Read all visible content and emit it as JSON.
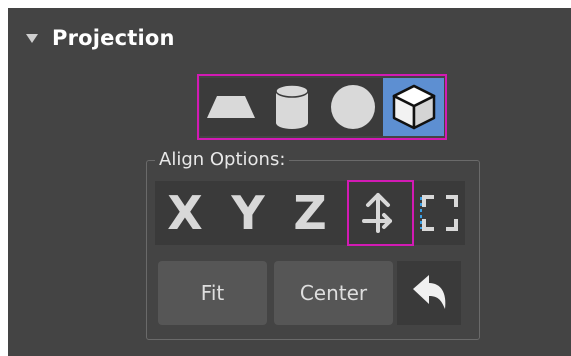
{
  "rollout": {
    "title": "Projection"
  },
  "projection": {
    "buttons": [
      {
        "name": "planar-icon",
        "active": false
      },
      {
        "name": "cylinder-icon",
        "active": false
      },
      {
        "name": "sphere-icon",
        "active": false
      },
      {
        "name": "box-icon",
        "active": true
      }
    ]
  },
  "align": {
    "label": "Align Options:",
    "x_label": "X",
    "y_label": "Y",
    "z_label": "Z",
    "fit_label": "Fit",
    "center_label": "Center"
  },
  "colors": {
    "panel_bg": "#444444",
    "active_blue": "#5d8fd2",
    "highlight_magenta": "#d21ab4",
    "icon_gray": "#d9d9d9"
  }
}
